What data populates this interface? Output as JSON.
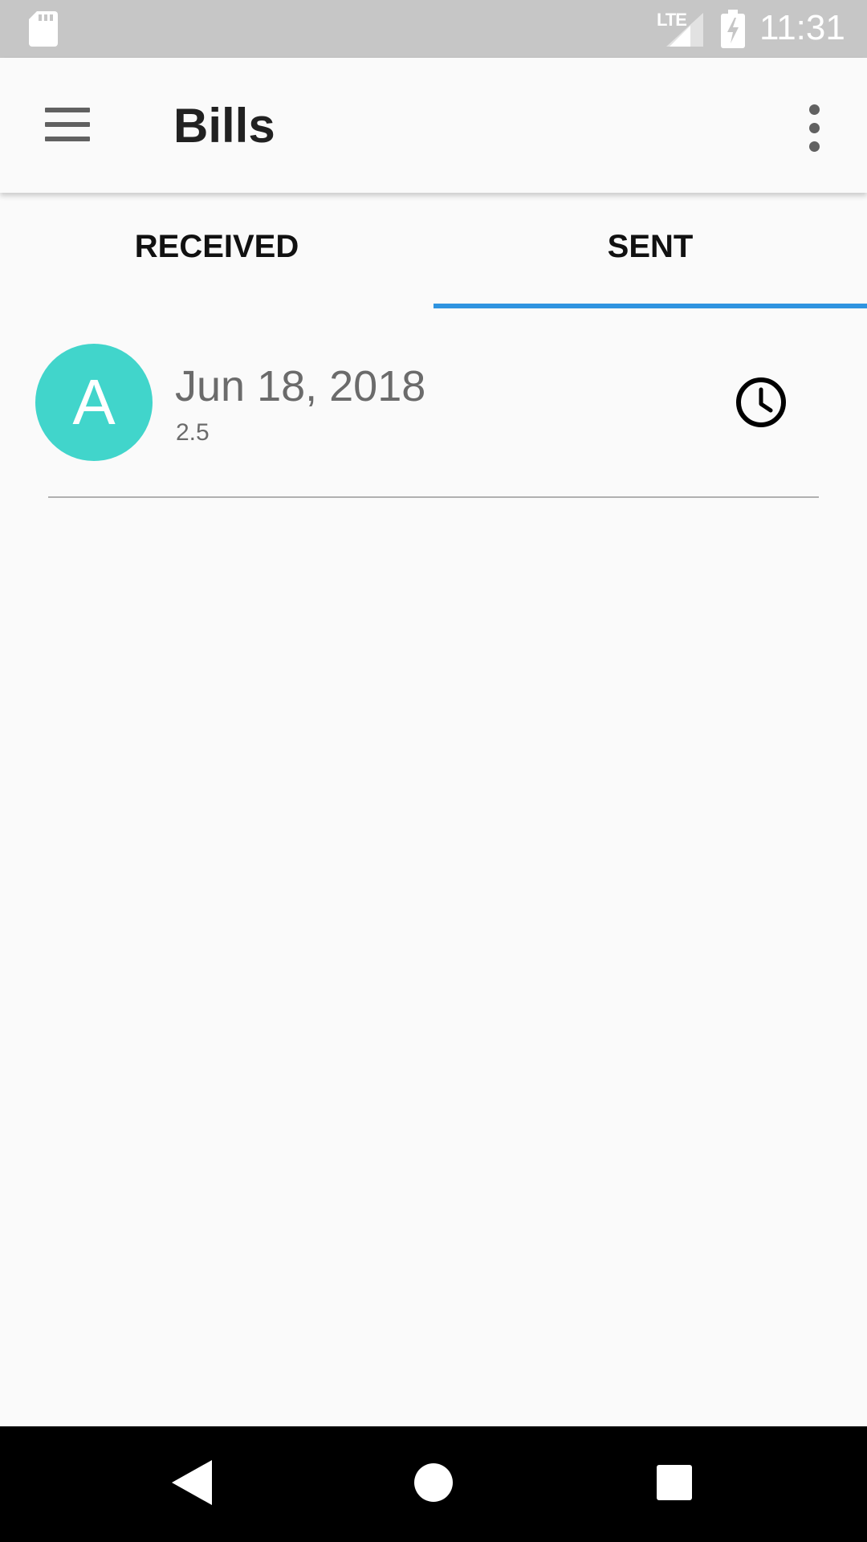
{
  "status_bar": {
    "network": "LTE",
    "time": "11:31",
    "icons": [
      "sd-card-icon",
      "signal-icon",
      "battery-charging-icon"
    ]
  },
  "app_bar": {
    "title": "Bills",
    "icons": [
      "menu-icon",
      "more-vert-icon"
    ]
  },
  "tabs": {
    "items": [
      {
        "label": "RECEIVED",
        "selected": false
      },
      {
        "label": "SENT",
        "selected": true
      }
    ],
    "indicator_color": "#2f94e0"
  },
  "bills": [
    {
      "avatar_letter": "A",
      "avatar_color": "#41d5cb",
      "date": "Jun 18, 2018",
      "amount": "2.5",
      "status_icon": "clock-icon"
    }
  ],
  "nav_bar": {
    "icons": [
      "back-icon",
      "home-icon",
      "recents-icon"
    ]
  }
}
